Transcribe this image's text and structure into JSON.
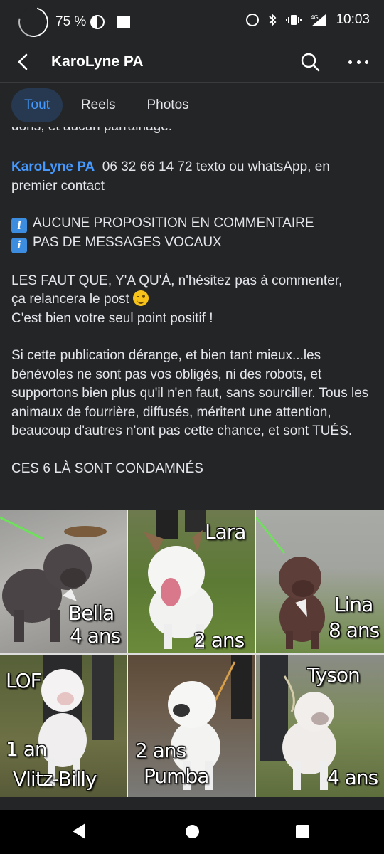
{
  "status_bar": {
    "battery": "75 %",
    "network": "4G",
    "time": "10:03"
  },
  "header": {
    "title": "KaroLyne PA"
  },
  "tabs": [
    {
      "label": "Tout",
      "active": true
    },
    {
      "label": "Reels",
      "active": false
    },
    {
      "label": "Photos",
      "active": false
    }
  ],
  "post": {
    "cut_line": "dons, et aucun parrainage.",
    "contact_name": "KaroLyne PA",
    "contact_text": "06 32 66 14 72 texto ou whatsApp, en premier contact",
    "info_lines": [
      "AUCUNE PROPOSITION EN COMMENTAIRE",
      "PAS DE MESSAGES VOCAUX"
    ],
    "para1_line1": "LES FAUT QUE, Y'A QU'À, n'hésitez pas à commenter,",
    "para1_line2": "ça relancera le post",
    "para1_line3": "C'est bien votre seul point positif !",
    "para2": "Si cette publication dérange, et bien tant mieux...les bénévoles ne sont pas vos obligés, ni des robots, et supportons bien plus qu'il n'en faut, sans sourciller. Tous les animaux de fourrière, diffusés, méritent une attention, beaucoup d'autres n'ont pas cette chance, et sont TUÉS.",
    "condemned": "CES 6 LÀ SONT CONDAMNÉS"
  },
  "dogs": [
    {
      "name": "Bella",
      "age": "4 ans"
    },
    {
      "name": "Lara",
      "age": "2 ans"
    },
    {
      "name": "Lina",
      "age": "8 ans"
    },
    {
      "name": "LOF",
      "age": "1 an",
      "extra": "Vlitz-Billy"
    },
    {
      "name": "Pumba",
      "age": "2 ans"
    },
    {
      "name": "Tyson",
      "age": "4 ans"
    }
  ],
  "colors": {
    "background": "#242526",
    "link": "#4599ff",
    "active_tab_bg": "#263951",
    "text": "#e4e6eb"
  },
  "icons": [
    "back-arrow-icon",
    "search-icon",
    "more-dots-icon",
    "info-icon",
    "wink-emoji-icon",
    "alarm-icon",
    "bluetooth-icon",
    "vibrate-icon",
    "signal-icon"
  ]
}
